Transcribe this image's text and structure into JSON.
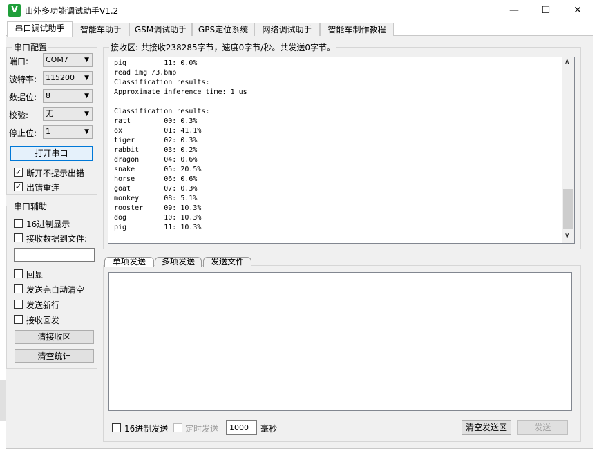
{
  "window": {
    "title": "山外多功能调试助手V1.2",
    "logo_letter": "V",
    "minimize": "—",
    "maximize": "☐",
    "close": "✕"
  },
  "tabs": [
    "串口调试助手",
    "智能车助手",
    "GSM调试助手",
    "GPS定位系统",
    "网络调试助手",
    "智能车制作教程"
  ],
  "serial_config": {
    "title": "串口配置",
    "port_label": "端口:",
    "port_value": "COM7",
    "baud_label": "波特率:",
    "baud_value": "115200",
    "databits_label": "数据位:",
    "databits_value": "8",
    "parity_label": "校验:",
    "parity_value": "无",
    "stopbits_label": "停止位:",
    "stopbits_value": "1",
    "open_button": "打开串口",
    "no_error_prompt_label": "断开不提示出错",
    "reconnect_label": "出错重连"
  },
  "serial_aux": {
    "title": "串口辅助",
    "hex_display_label": "16进制显示",
    "save_to_file_label": "接收数据到文件:",
    "echo_label": "回显",
    "auto_clear_label": "发送完自动清空",
    "newline_label": "发送新行",
    "rx_reply_label": "接收回发",
    "clear_rx_button": "清接收区",
    "clear_stats_button": "清空统计"
  },
  "receive": {
    "status": "接收区: 共接收238285字节，速度0字节/秒。共发送0字节。",
    "lines": [
      "pig         11: 0.0%",
      "read img /3.bmp",
      "Classification results:",
      "Approximate inference time: 1 us",
      "",
      "Classification results:",
      "ratt        00: 0.3%",
      "ox          01: 41.1%",
      "tiger       02: 0.3%",
      "rabbit      03: 0.2%",
      "dragon      04: 0.6%",
      "snake       05: 20.5%",
      "horse       06: 0.6%",
      "goat        07: 0.3%",
      "monkey      08: 5.1%",
      "rooster     09: 10.3%",
      "dog         10: 10.3%",
      "pig         11: 10.3%"
    ]
  },
  "send": {
    "tabs": [
      "单项发送",
      "多项发送",
      "发送文件"
    ],
    "hex_send_label": "16进制发送",
    "timed_send_label": "定时发送",
    "interval_value": "1000",
    "interval_unit": "毫秒",
    "clear_send_button": "清空发送区",
    "send_button": "发送"
  },
  "scroll_icons": {
    "up": "∧",
    "down": "∨"
  }
}
